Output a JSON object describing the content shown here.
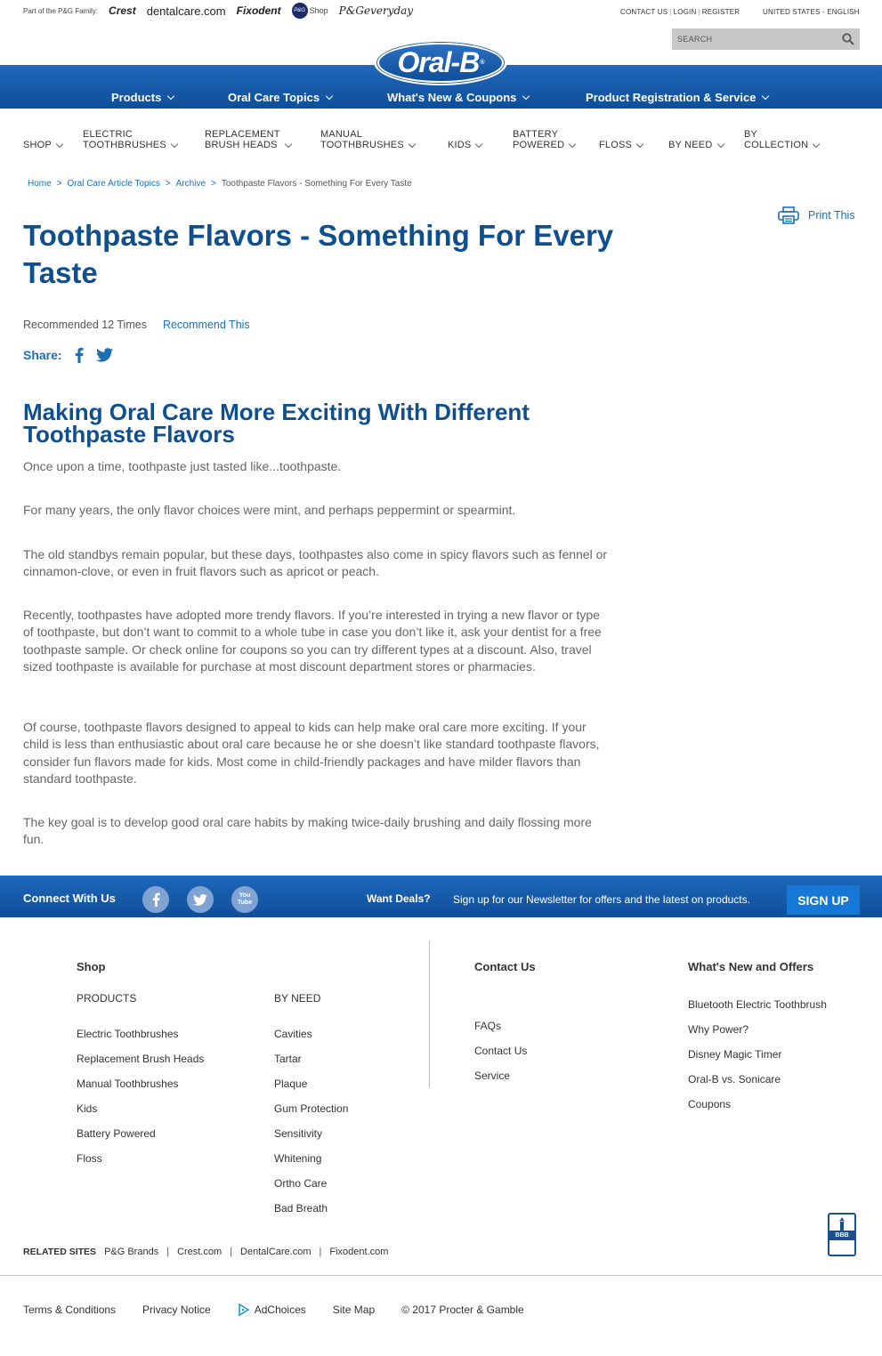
{
  "top": {
    "family_label": "Part of the P&G Family:",
    "brands": [
      "Crest",
      "dentalcare.com",
      "Fixodent",
      "P&G",
      "Shop",
      "P&Geveryday"
    ],
    "util_links": [
      "CONTACT US",
      "LOGIN",
      "REGISTER"
    ],
    "locale": "UNITED STATES - ENGLISH",
    "search_placeholder": "SEARCH",
    "logo": "Oral-B",
    "logo_mark": "®"
  },
  "main_nav": [
    "Products",
    "Oral Care Topics",
    "What's New & Coupons",
    "Product Registration & Service"
  ],
  "cat_nav": [
    {
      "l1": "",
      "l2": "SHOP"
    },
    {
      "l1": "ELECTRIC",
      "l2": "TOOTHBRUSHES"
    },
    {
      "l1": "REPLACEMENT",
      "l2": "BRUSH HEADS"
    },
    {
      "l1": "MANUAL",
      "l2": "TOOTHBRUSHES"
    },
    {
      "l1": "",
      "l2": "KIDS"
    },
    {
      "l1": "BATTERY",
      "l2": "POWERED"
    },
    {
      "l1": "",
      "l2": "FLOSS"
    },
    {
      "l1": "",
      "l2": "BY NEED"
    },
    {
      "l1": "BY",
      "l2": "COLLECTION"
    }
  ],
  "breadcrumb": [
    "Home",
    "Oral Care Article Topics",
    "Archive",
    "Toothpaste Flavors - Something For Every Taste"
  ],
  "breadcrumb_sep": ">",
  "print_label": "Print This",
  "article": {
    "title": "Toothpaste Flavors - Something For Every Taste",
    "recommended": "Recommended 12 Times",
    "recommend_link": "Recommend This",
    "share_label": "Share:",
    "heading": "Making Oral Care More Exciting With Different Toothpaste Flavors",
    "paragraphs": [
      "Once upon a time, toothpaste just tasted like...toothpaste.",
      "For many years, the only flavor choices were mint, and perhaps peppermint or spearmint.",
      "The old standbys remain popular, but these days, toothpastes also come in spicy flavors such as fennel or cinnamon-clove, or even in fruit flavors such as apricot or peach.",
      "Recently, toothpastes have adopted more trendy flavors. If you’re interested in trying a new flavor or type of toothpaste, but don’t want to commit to a whole tube in case you don’t like it, ask your dentist for a free toothpaste sample. Or check online for coupons so you can try different types at a discount. Also, travel sized toothpaste is available for purchase at most discount department stores or pharmacies.",
      "Of course, toothpaste flavors designed to appeal to kids can help make oral care more exciting. If your child is less than enthusiastic about oral care because he or she doesn’t like standard toothpaste flavors, consider fun flavors made for kids. Most come in child-friendly packages and have milder flavors than standard toothpaste.",
      "The key goal is to develop good oral care habits by making twice-daily brushing and daily flossing more fun."
    ]
  },
  "connect": {
    "title": "Connect With Us",
    "youtube_label": "You Tube",
    "deals": "Want Deals?",
    "newsletter": "Sign up for our Newsletter for offers and the latest on products.",
    "signup": "SIGN UP"
  },
  "footer": {
    "shop_title": "Shop",
    "products_title": "PRODUCTS",
    "products": [
      "Electric Toothbrushes",
      "Replacement Brush Heads",
      "Manual Toothbrushes",
      "Kids",
      "Battery Powered",
      "Floss"
    ],
    "byneed_title": "BY NEED",
    "byneed": [
      "Cavities",
      "Tartar",
      "Plaque",
      "Gum Protection",
      "Sensitivity",
      "Whitening",
      "Ortho Care",
      "Bad Breath"
    ],
    "contact_title": "Contact Us",
    "contact": [
      "FAQs",
      "Contact Us",
      "Service"
    ],
    "whatsnew_title": "What's New and Offers",
    "whatsnew": [
      "Bluetooth Electric Toothbrush",
      "Why Power?",
      "Disney Magic Timer",
      "Oral-B vs. Sonicare",
      "Coupons"
    ],
    "related_title": "RELATED SITES",
    "related": [
      "P&G Brands",
      "Crest.com",
      "DentalCare.com",
      "Fixodent.com"
    ],
    "related_sep": "|",
    "bbb": "BBB",
    "bottom": [
      "Terms & Conditions",
      "Privacy Notice",
      "AdChoices",
      "Site Map",
      "© 2017 Procter & Gamble"
    ]
  },
  "colors": {
    "brand_blue": "#0e4f8f",
    "nav_blue": "#1a5ea9",
    "link_blue": "#1b6fb5",
    "signup_blue": "#1478d4"
  }
}
